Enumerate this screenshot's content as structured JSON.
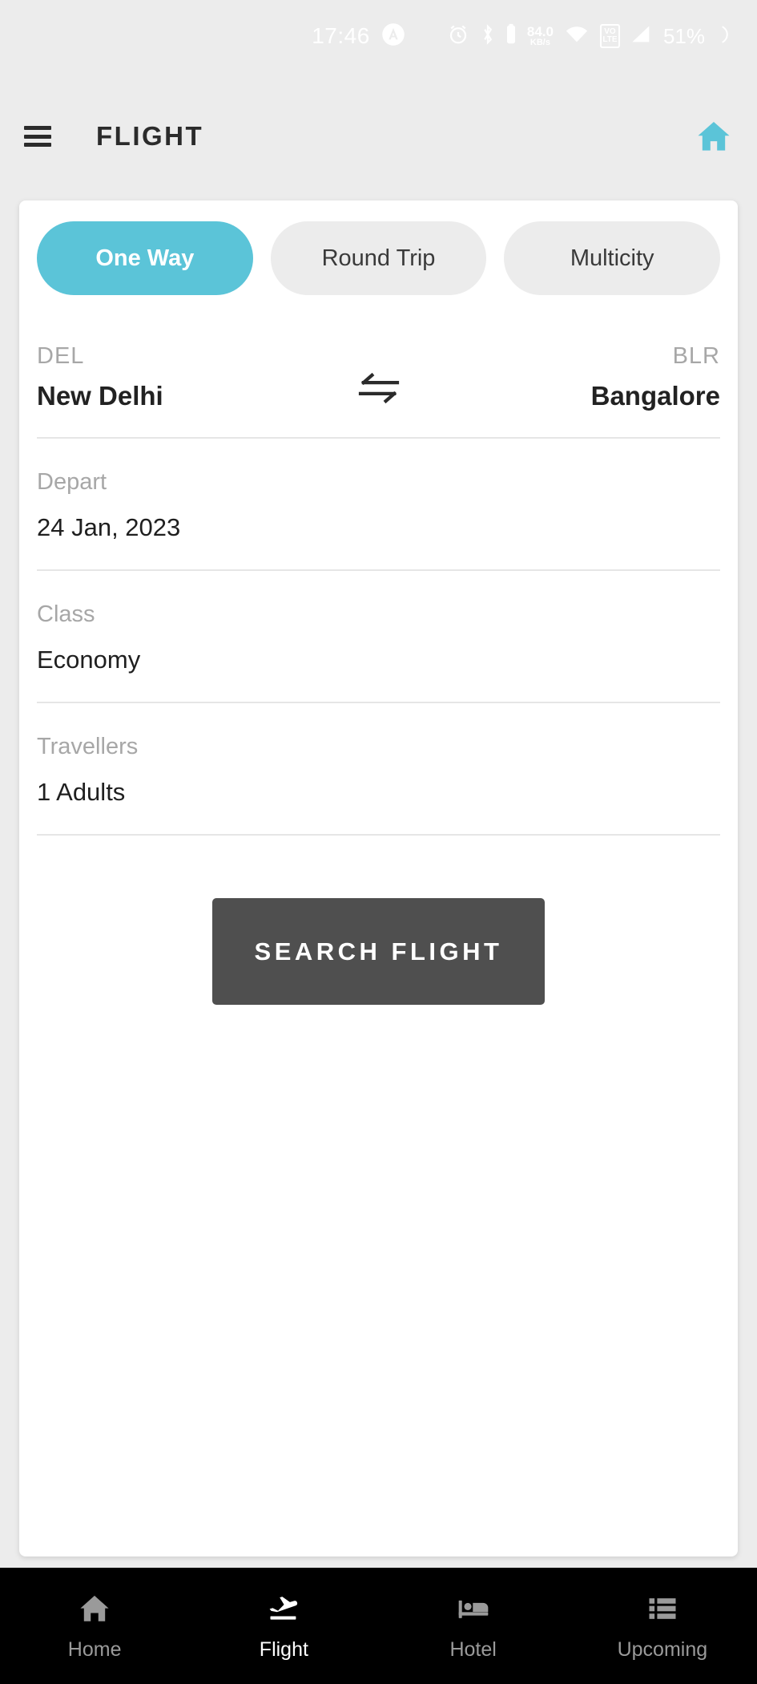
{
  "status_bar": {
    "time": "17:46",
    "battery_percent": "51%",
    "net_speed_value": "84.0",
    "net_speed_unit": "KB/s",
    "volte_top": "VO",
    "volte_bottom": "LTE",
    "icons": [
      "alarm-icon",
      "bluetooth-icon",
      "battery-icon",
      "wifi-icon",
      "volte-icon",
      "signal-icon",
      "moon-icon"
    ],
    "text_color": "#ffffff"
  },
  "app_bar": {
    "menu_icon": "hamburger-menu-icon",
    "title": "FLIGHT",
    "home_icon": "home-icon",
    "accent_color": "#5bc4d8"
  },
  "trip_tabs": {
    "items": [
      {
        "label": "One Way",
        "active": true
      },
      {
        "label": "Round Trip",
        "active": false
      },
      {
        "label": "Multicity",
        "active": false
      }
    ],
    "active_bg": "#5bc4d8",
    "inactive_bg": "#ececec"
  },
  "route": {
    "origin": {
      "code": "DEL",
      "city": "New Delhi"
    },
    "destination": {
      "code": "BLR",
      "city": "Bangalore"
    },
    "swap_icon": "swap-arrows-icon"
  },
  "fields": [
    {
      "label": "Depart",
      "value": "24 Jan, 2023",
      "name": "depart"
    },
    {
      "label": "Class",
      "value": "Economy",
      "name": "class"
    },
    {
      "label": "Travellers",
      "value": "1 Adults",
      "name": "travellers"
    }
  ],
  "search_button": {
    "label": "SEARCH FLIGHT",
    "bg_color": "#4f4f4f"
  },
  "bottom_nav": {
    "items": [
      {
        "label": "Home",
        "icon": "home-icon",
        "active": false
      },
      {
        "label": "Flight",
        "icon": "flight-takeoff-icon",
        "active": true
      },
      {
        "label": "Hotel",
        "icon": "hotel-bed-icon",
        "active": false
      },
      {
        "label": "Upcoming",
        "icon": "list-icon",
        "active": false
      }
    ],
    "bg_color": "#000000",
    "active_color": "#ffffff",
    "inactive_color": "#9a9a9a"
  }
}
